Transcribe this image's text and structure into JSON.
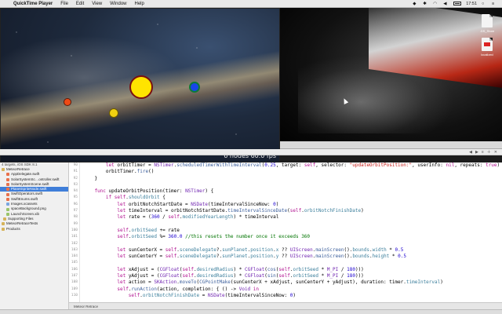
{
  "menubar": {
    "apple": "",
    "app_name": "QuickTime Player",
    "menus": [
      "File",
      "Edit",
      "View",
      "Window",
      "Help"
    ],
    "status_time": "17:51"
  },
  "simulator": {
    "fps_text": "6 nodes  60.0 fps"
  },
  "desktop": {
    "icons": [
      {
        "label": ".DS_Store"
      },
      {
        "label": "localized"
      }
    ]
  },
  "navigator": {
    "header": "4 targets, iOS SDK 8.1",
    "items": [
      {
        "label": "MeteorRetrace",
        "icon": "folder"
      },
      {
        "label": "AppDelegate.swift",
        "icon": "swift"
      },
      {
        "label": "SolarSystemSc…ontroller.swift",
        "icon": "swift"
      },
      {
        "label": "SolarSystemScene.swift",
        "icon": "swift"
      },
      {
        "label": "PlanetSpriteNode.swift",
        "icon": "swift"
      },
      {
        "label": "SwiftOperators.swift",
        "icon": "swift"
      },
      {
        "label": "SwiftEnums.swift",
        "icon": "swift"
      },
      {
        "label": "Images.xcassets",
        "icon": "asset"
      },
      {
        "label": "spaceBackground.png",
        "icon": "img"
      },
      {
        "label": "LaunchScreen.xib",
        "icon": "img"
      },
      {
        "label": "Supporting Files",
        "icon": "folder"
      },
      {
        "label": "MeteorRetraceTests",
        "icon": "folder"
      },
      {
        "label": "Products",
        "icon": "folder"
      }
    ],
    "selected_index": 4
  },
  "editor": {
    "line_numbers": [
      "",
      "",
      "",
      "",
      "",
      "",
      "",
      "",
      "",
      "",
      "",
      "",
      "",
      "",
      "",
      "",
      "",
      "",
      "",
      "",
      ""
    ],
    "status_text": "Meteor Retrace"
  }
}
